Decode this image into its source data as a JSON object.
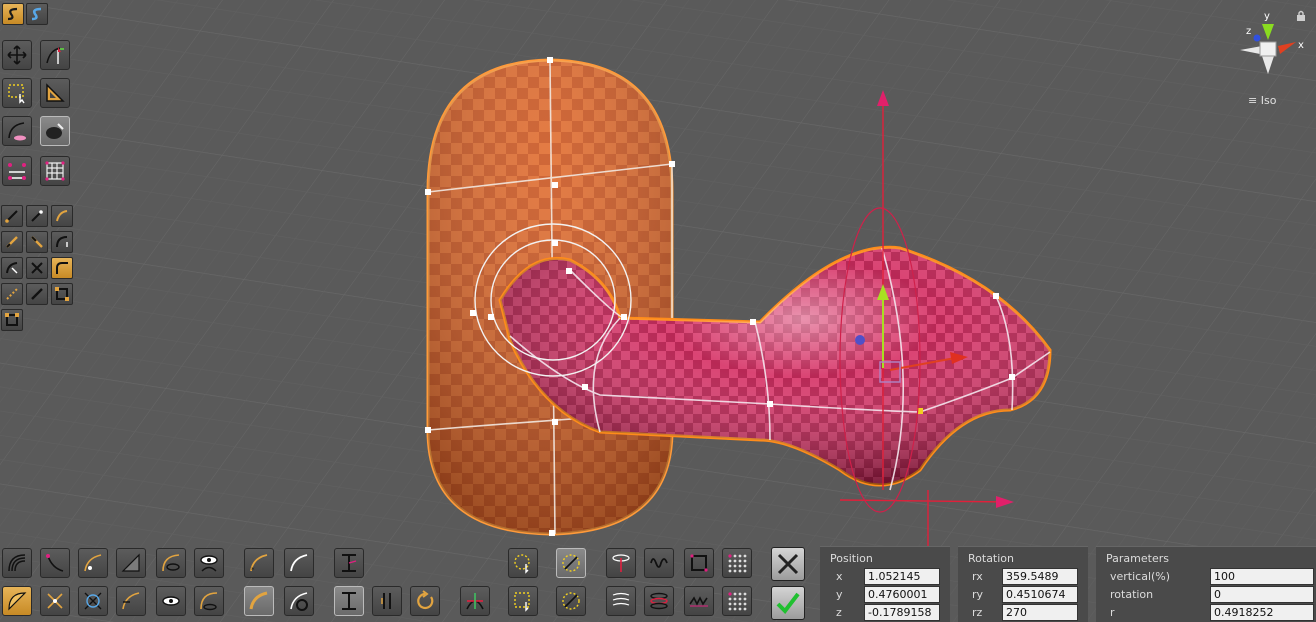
{
  "viewport": {
    "view_label": "Iso",
    "gizmo_axes": {
      "x": "x",
      "y": "y",
      "z": "z"
    }
  },
  "position": {
    "title": "Position",
    "x_label": "x",
    "x": "1.052145",
    "y_label": "y",
    "y": "0.4760001",
    "z_label": "z",
    "z": "-0.1789158"
  },
  "rotation": {
    "title": "Rotation",
    "rx_label": "rx",
    "rx": "359.5489",
    "ry_label": "ry",
    "ry": "0.4510674",
    "rz_label": "rz",
    "rz": "270"
  },
  "parameters": {
    "title": "Parameters",
    "vertical_label": "vertical(%)",
    "vertical": "100",
    "rotation_label": "rotation",
    "rotation": "0",
    "r_label": "r",
    "r": "0.4918252"
  },
  "colors": {
    "background": "#5a5a5a",
    "orange_mesh": "#d8581c",
    "pink_mesh": "#c8245a",
    "accent_gold": "#e2a440",
    "selection_outline": "#ff8c1a",
    "axis_red": "#e0203a",
    "axis_green": "#a8e020",
    "axis_blue": "#5050c8"
  }
}
